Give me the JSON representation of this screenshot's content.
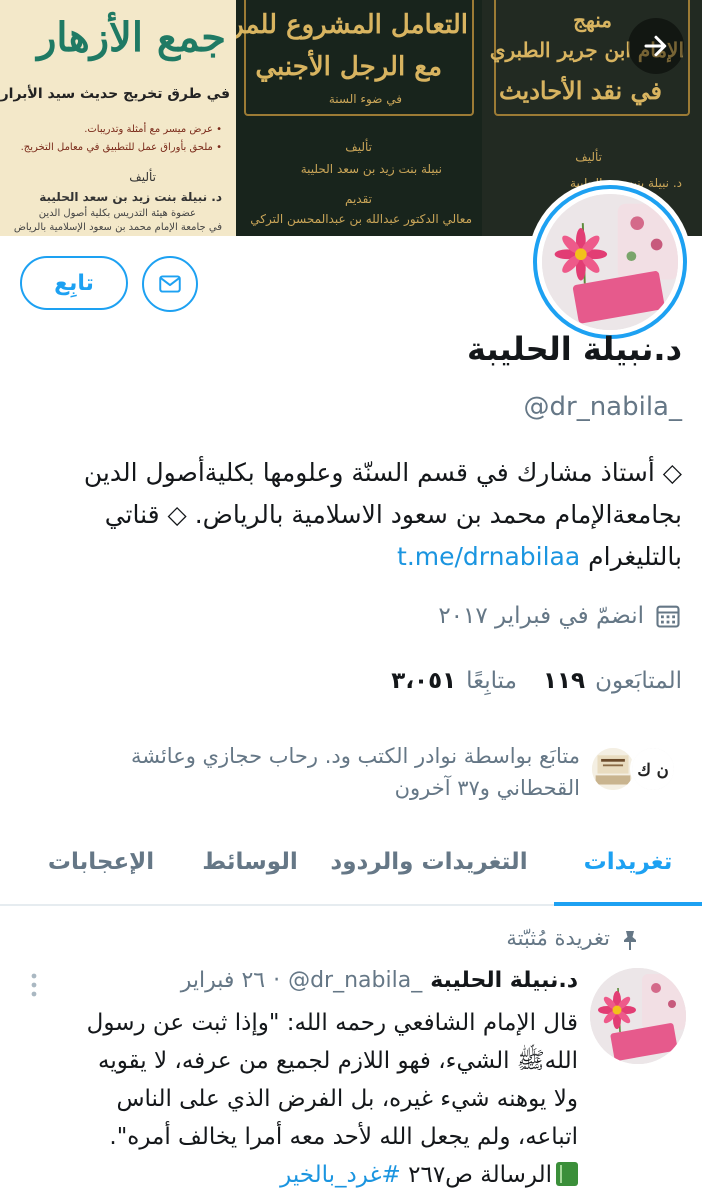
{
  "banner": {
    "book1": {
      "title": "جمع الأزهار",
      "subtitle": "في طرق تخريج حديث سيد الأبرار",
      "line1": "• عرض ميسر مع أمثلة وتدريبات.",
      "line2": "• ملحق بأوراق عمل للتطبيق في معامل التخريج.",
      "author_label": "تأليف",
      "author": "د. نبيلة بنت زيد بن سعد الحليبة",
      "affil1": "عضوة هيئة التدريس بكلية أصول الدين",
      "affil2": "في جامعة الإمام محمد بن سعود الإسلامية بالرياض"
    },
    "book2": {
      "title1": "التعامل المشروع للمرأة",
      "title2": "مع الرجل الأجنبي",
      "sub": "في ضوء السنة",
      "author_label": "تأليف",
      "author": "نبيلة بنت زيد بن سعد الحليبة",
      "intro_label": "تقديم",
      "intro": "معالي الدكتور عبدالله بن عبدالمحسن التركي"
    },
    "book3": {
      "title1": "منهج",
      "title2": "الإمام ابن جرير الطبري",
      "title3": "في نقد الأحاديث",
      "author_label": "تأليف",
      "author": "د. نبيلة بنت زيد الحليبة"
    }
  },
  "profile": {
    "follow_label": "تابِع",
    "name": "د.نبيلة الحليبة",
    "handle": "@dr_nabila_",
    "bio_line1": "◇ أستاذ مشارك في قسم السنّة وعلومها بكليةأصول الدين",
    "bio_line2": "بجامعةالإمام محمد بن سعود الاسلامية بالرياض. ◇ قناتي",
    "bio_line3_text": "بالتليغرام ",
    "bio_link": "t.me/drnabilaa",
    "joined": "انضمّ في فبراير ٢٠١٧",
    "following_count": "١١٩",
    "following_label": "المتابَعون",
    "followers_count": "٣،٠٥١",
    "followers_label": "متابِعًا",
    "followed_by_line1": "متابَع بواسطة نوادر الكتب ود. رحاب حجازي وعائشة",
    "followed_by_line2": "القحطاني و٣٧ آخرون"
  },
  "tabs": [
    {
      "label": "تغريدات",
      "active": true
    },
    {
      "label": "التغريدات والردود",
      "active": false
    },
    {
      "label": "الوسائط",
      "active": false
    },
    {
      "label": "الإعجابات",
      "active": false
    }
  ],
  "pinned_tweet": {
    "pinned_label": "تغريدة مُثبّتة",
    "name": "د.نبيلة الحليبة",
    "handle": "@dr_nabila_",
    "separator": "·",
    "time": "٢٦ فبراير",
    "line1": "قال الإمام الشافعي رحمه الله: \"وإذا ثبت عن رسول",
    "line2": "اللهﷺ الشيء، فهو اللازم لجميع من عرفه، لا يقويه",
    "line3": "ولا يوهنه شيء غيره، بل الفرض الذي على الناس",
    "line4": "اتباعه، ولم يجعل الله لأحد معه أمرا يخالف أمره\".",
    "line5_text": "الرسالة ص٢٦٧ ",
    "hashtag": "#غرد_بالخير"
  },
  "colors": {
    "accent": "#1da1f2",
    "secondary_text": "#657786",
    "link": "#1b95e0"
  },
  "icons": {
    "banner_next": "arrow-right-icon",
    "message": "envelope-icon",
    "calendar": "calendar-icon",
    "pin": "pin-icon",
    "more": "more-vertical-icon"
  }
}
